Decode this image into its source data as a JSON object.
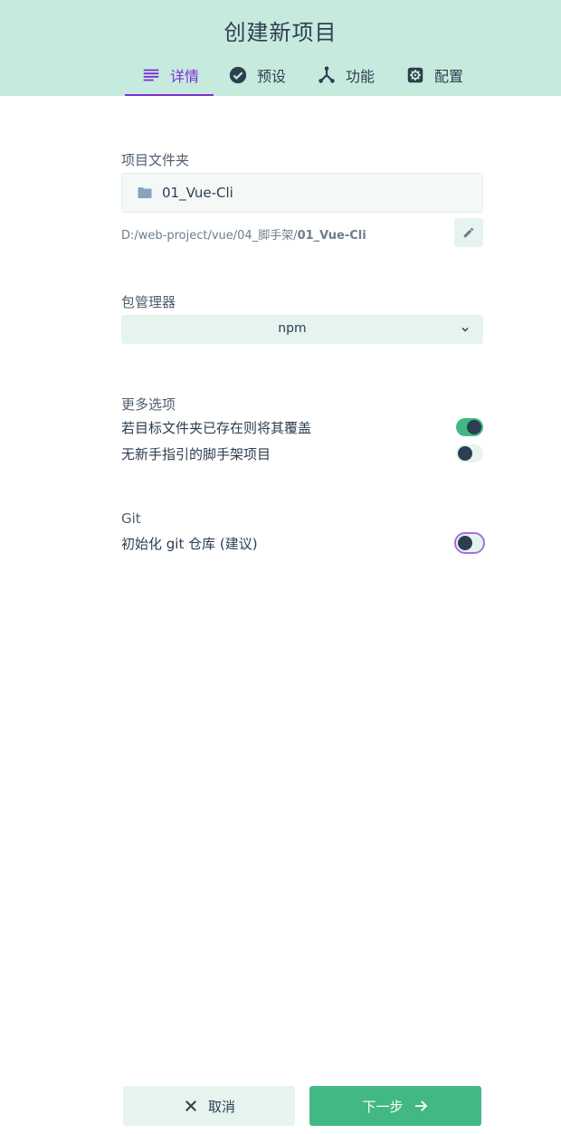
{
  "header": {
    "title": "创建新项目",
    "tabs": [
      {
        "label": "详情",
        "icon": "list-icon",
        "active": true
      },
      {
        "label": "预设",
        "icon": "check-circle-icon",
        "active": false
      },
      {
        "label": "功能",
        "icon": "merge-type-icon",
        "active": false
      },
      {
        "label": "配置",
        "icon": "settings-icon",
        "active": false
      }
    ]
  },
  "project_folder": {
    "label": "项目文件夹",
    "value": "01_Vue-Cli",
    "path_prefix": "D:/web-project/vue/04_脚手架/",
    "path_name": "01_Vue-Cli"
  },
  "package_manager": {
    "label": "包管理器",
    "selected": "npm"
  },
  "more_options": {
    "label": "更多选项",
    "items": [
      {
        "label": "若目标文件夹已存在则将其覆盖",
        "enabled": true
      },
      {
        "label": "无新手指引的脚手架项目",
        "enabled": false
      }
    ]
  },
  "git": {
    "label": "Git",
    "items": [
      {
        "label": "初始化 git 仓库 (建议)",
        "enabled": false
      }
    ]
  },
  "footer": {
    "cancel_label": "取消",
    "next_label": "下一步"
  },
  "colors": {
    "header_bg": "#c7eade",
    "accent": "#42b983",
    "active_tab": "#7b2fd1",
    "text": "#2c3e50"
  }
}
